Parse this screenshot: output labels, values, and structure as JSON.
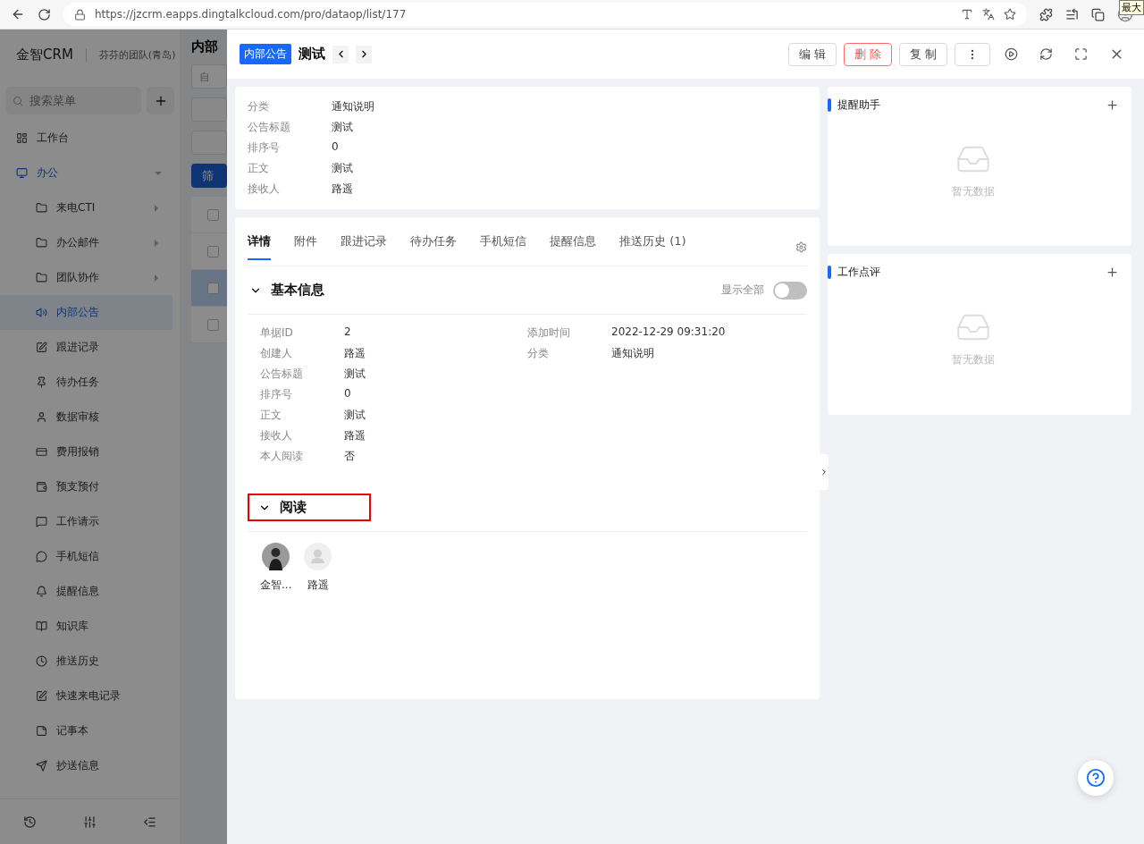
{
  "browser": {
    "url": "https://jzcrm.eapps.dingtalkcloud.com/pro/dataop/list/177",
    "tooltip": "最大"
  },
  "app": {
    "logo": "金智CRM",
    "team": "芬芬的团队(青岛)",
    "search_placeholder": "搜索菜单",
    "menu": [
      {
        "label": "工作台",
        "selected": false
      },
      {
        "label": "办公",
        "selected": true,
        "expanded": true,
        "children": [
          {
            "label": "来电CTI",
            "selected": false,
            "has_children": true
          },
          {
            "label": "办公邮件",
            "selected": false,
            "has_children": true
          },
          {
            "label": "团队协作",
            "selected": false,
            "has_children": true
          },
          {
            "label": "内部公告",
            "selected": true,
            "has_children": false
          },
          {
            "label": "跟进记录",
            "selected": false,
            "has_children": false
          },
          {
            "label": "待办任务",
            "selected": false,
            "has_children": false
          },
          {
            "label": "数据审核",
            "selected": false,
            "has_children": false
          },
          {
            "label": "费用报销",
            "selected": false,
            "has_children": false
          },
          {
            "label": "预支预付",
            "selected": false,
            "has_children": false
          },
          {
            "label": "工作请示",
            "selected": false,
            "has_children": false
          },
          {
            "label": "手机短信",
            "selected": false,
            "has_children": false
          },
          {
            "label": "提醒信息",
            "selected": false,
            "has_children": false
          },
          {
            "label": "知识库",
            "selected": false,
            "has_children": false
          },
          {
            "label": "推送历史",
            "selected": false,
            "has_children": false
          },
          {
            "label": "快速来电记录",
            "selected": false,
            "has_children": false
          },
          {
            "label": "记事本",
            "selected": false,
            "has_children": false
          },
          {
            "label": "抄送信息",
            "selected": false,
            "has_children": false
          }
        ]
      }
    ],
    "page_title": "内部",
    "filter_value": "自",
    "filter_button": "筛",
    "rows": [
      {
        "selected": false
      },
      {
        "selected": false
      },
      {
        "selected": true
      },
      {
        "selected": false
      }
    ]
  },
  "drawer": {
    "tag": "内部公告",
    "title": "测试",
    "actions": [
      {
        "kind": "default",
        "label": "编 辑"
      },
      {
        "kind": "danger",
        "label": "删 除"
      },
      {
        "kind": "default",
        "label": "复 制"
      },
      {
        "kind": "more"
      }
    ],
    "summary": [
      {
        "label": "分类",
        "value": "通知说明"
      },
      {
        "label": "公告标题",
        "value": "测试"
      },
      {
        "label": "排序号",
        "value": "0"
      },
      {
        "label": "正文",
        "value": "测试"
      },
      {
        "label": "接收人",
        "value": "路遥"
      }
    ],
    "tabs": [
      {
        "label": "详情",
        "selected": true
      },
      {
        "label": "附件",
        "selected": false
      },
      {
        "label": "跟进记录",
        "selected": false
      },
      {
        "label": "待办任务",
        "selected": false
      },
      {
        "label": "手机短信",
        "selected": false
      },
      {
        "label": "提醒信息",
        "selected": false
      },
      {
        "label": "推送历史 (1)",
        "selected": false
      }
    ],
    "basic": {
      "title": "基本信息",
      "expanded": true,
      "show_all": {
        "label": "显示全部",
        "on": false
      },
      "left": [
        {
          "label": "单据ID",
          "value": "2"
        },
        {
          "label": "创建人",
          "value": "路遥"
        },
        {
          "label": "公告标题",
          "value": "测试"
        },
        {
          "label": "排序号",
          "value": "0"
        },
        {
          "label": "正文",
          "value": "测试"
        },
        {
          "label": "接收人",
          "value": "路遥"
        },
        {
          "label": "本人阅读",
          "value": "否"
        }
      ],
      "right": [
        {
          "label": "添加时间",
          "value": "2022-12-29 09:31:20"
        },
        {
          "label": "分类",
          "value": "通知说明"
        }
      ]
    },
    "reading": {
      "title": "阅读",
      "expanded": true,
      "highlighted": true,
      "readers": [
        {
          "name": "金智...",
          "kind": "photo"
        },
        {
          "name": "路遥",
          "kind": "default"
        }
      ]
    },
    "panels": [
      {
        "title": "提醒助手",
        "empty_text": "暂无数据"
      },
      {
        "title": "工作点评",
        "empty_text": "暂无数据"
      }
    ]
  }
}
